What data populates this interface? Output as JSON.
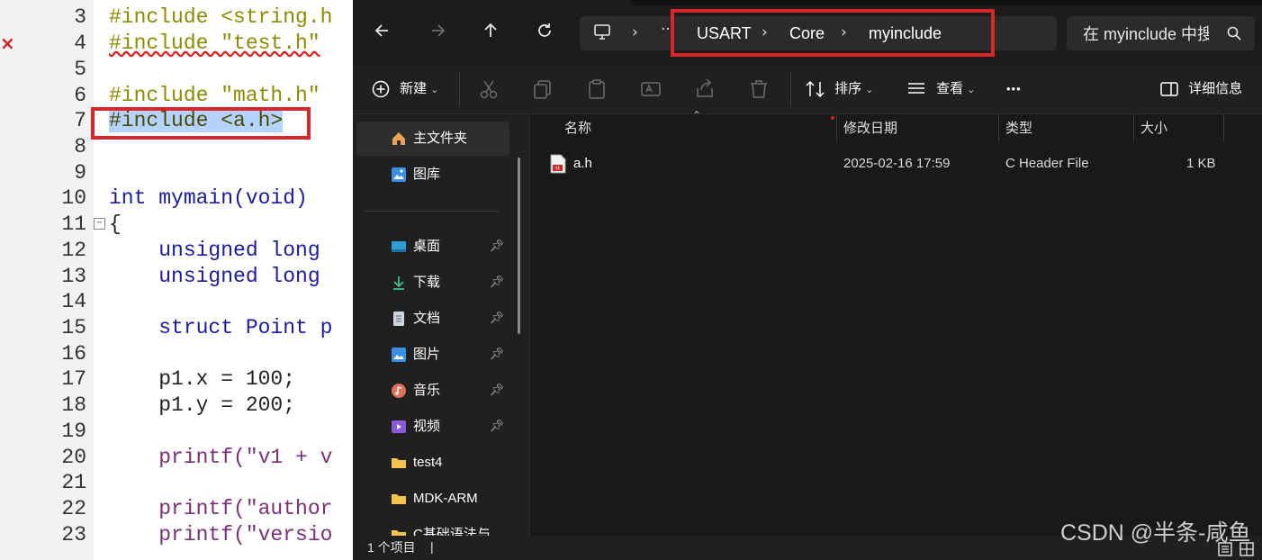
{
  "editor": {
    "lines": [
      {
        "num": "3",
        "text": "#include <string.h"
      },
      {
        "num": "4",
        "text": "#include \"test.h\""
      },
      {
        "num": "5",
        "text": ""
      },
      {
        "num": "6",
        "text": "#include \"math.h\""
      },
      {
        "num": "7",
        "text": "#include <a.h>"
      },
      {
        "num": "8",
        "text": ""
      },
      {
        "num": "9",
        "text": ""
      },
      {
        "num": "10",
        "text": "int mymain(void)"
      },
      {
        "num": "11",
        "text": "{"
      },
      {
        "num": "12",
        "text": "    unsigned long"
      },
      {
        "num": "13",
        "text": "    unsigned long"
      },
      {
        "num": "14",
        "text": ""
      },
      {
        "num": "15",
        "text": "    struct Point p"
      },
      {
        "num": "16",
        "text": ""
      },
      {
        "num": "17",
        "text": "    p1.x = 100;"
      },
      {
        "num": "18",
        "text": "    p1.y = 200;"
      },
      {
        "num": "19",
        "text": ""
      },
      {
        "num": "20",
        "text": "    printf(\"v1 + v"
      },
      {
        "num": "21",
        "text": ""
      },
      {
        "num": "22",
        "text": "    printf(\"author"
      },
      {
        "num": "23",
        "text": "    printf(\"versio"
      }
    ],
    "error_marker": "×",
    "fold_marker": "−"
  },
  "explorer": {
    "address": {
      "ellipsis": "···",
      "crumbs": [
        "USART",
        "Core",
        "myinclude"
      ]
    },
    "search_placeholder": "在 myinclude 中搜",
    "toolbar": {
      "new": "新建",
      "sort": "排序",
      "view": "查看",
      "more": "•••",
      "details": "详细信息"
    },
    "sidebar": {
      "items": [
        {
          "label": "主文件夹",
          "icon": "home-icon",
          "active": true
        },
        {
          "label": "图库",
          "icon": "gallery-icon"
        }
      ],
      "pinned": [
        {
          "label": "桌面",
          "icon": "desktop-icon"
        },
        {
          "label": "下载",
          "icon": "download-icon"
        },
        {
          "label": "文档",
          "icon": "document-icon"
        },
        {
          "label": "图片",
          "icon": "pictures-icon"
        },
        {
          "label": "音乐",
          "icon": "music-icon"
        },
        {
          "label": "视频",
          "icon": "video-icon"
        }
      ],
      "folders": [
        "test4",
        "MDK-ARM",
        "C基础语法与STI"
      ]
    },
    "columns": {
      "name": "名称",
      "date": "修改日期",
      "type": "类型",
      "size": "大小"
    },
    "files": [
      {
        "name": "a.h",
        "date": "2025-02-16 17:59",
        "type": "C Header File",
        "size": "1 KB"
      }
    ],
    "status": "1 个项目",
    "watermark": "CSDN @半条-咸鱼",
    "colors": {
      "highlight_box": "#d8262a",
      "folder": "#f4c24d"
    }
  }
}
